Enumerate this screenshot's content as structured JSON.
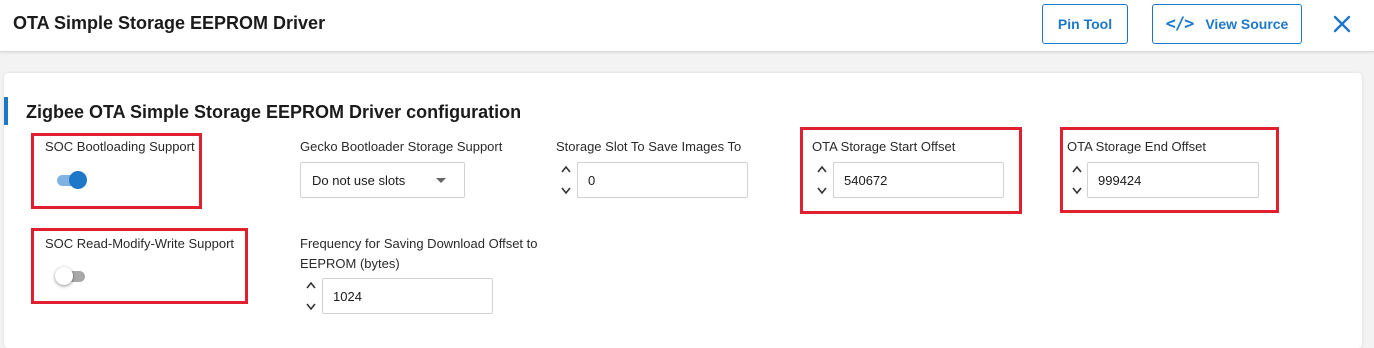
{
  "header": {
    "title": "OTA Simple Storage EEPROM Driver",
    "pin_tool_label": "Pin Tool",
    "view_source_label": "View Source"
  },
  "config": {
    "title": "Zigbee OTA Simple Storage EEPROM Driver configuration",
    "soc_bootloading": {
      "label": "SOC Bootloading Support",
      "enabled": true
    },
    "gecko_storage": {
      "label": "Gecko Bootloader Storage Support",
      "value": "Do not use slots"
    },
    "storage_slot": {
      "label": "Storage Slot To Save Images To",
      "value": "0"
    },
    "start_offset": {
      "label": "OTA Storage Start Offset",
      "value": "540672"
    },
    "end_offset": {
      "label": "OTA Storage End Offset",
      "value": "999424"
    },
    "soc_rmw": {
      "label": "SOC Read-Modify-Write Support",
      "enabled": false
    },
    "frequency": {
      "label_line1": "Frequency for Saving Download Offset to",
      "label_line2": "EEPROM (bytes)",
      "value": "1024"
    }
  },
  "colors": {
    "accent": "#1e78c8",
    "highlight": "#e0202e"
  }
}
